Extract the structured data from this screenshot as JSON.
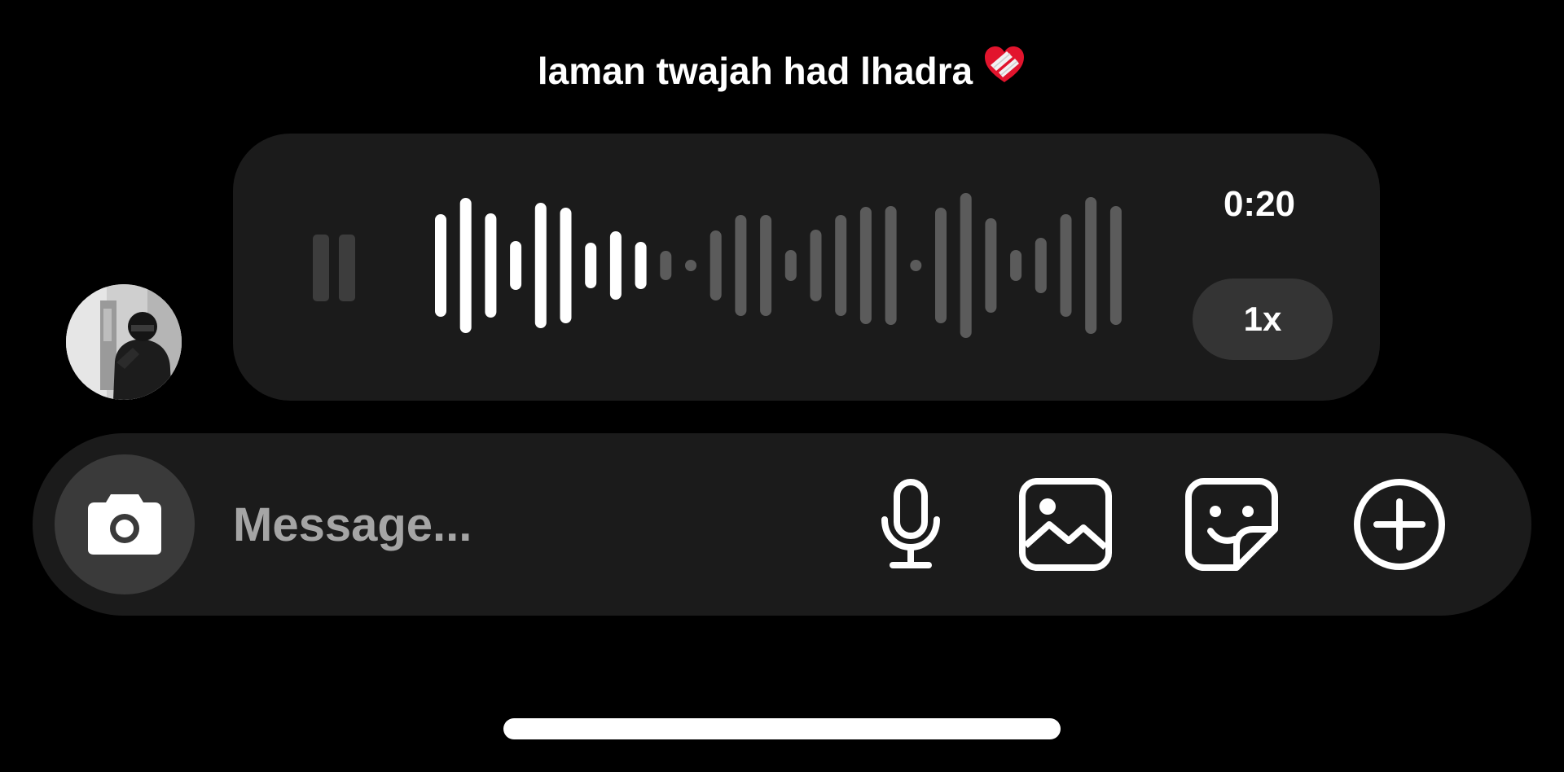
{
  "caption": {
    "text": "laman twajah had lhadra",
    "emoji_icon": "mending-heart-icon"
  },
  "voice_message": {
    "state_icon": "pause-icon",
    "duration": "0:20",
    "playback_speed": "1x",
    "playback_progress": 0.33,
    "waveform_levels": [
      0.63,
      0.83,
      0.64,
      0.3,
      0.77,
      0.71,
      0.28,
      0.42,
      0.29,
      0.18,
      0.04,
      0.43,
      0.62,
      0.62,
      0.19,
      0.44,
      0.62,
      0.72,
      0.73,
      0.02,
      0.71,
      0.89,
      0.58,
      0.19,
      0.34,
      0.63,
      0.84,
      0.73
    ],
    "played_color": "#ffffff",
    "unplayed_color": "#5b5b5b"
  },
  "composer": {
    "camera_icon": "camera-icon",
    "placeholder": "Message...",
    "value": "",
    "actions": [
      {
        "icon": "microphone-icon",
        "label": "microphone"
      },
      {
        "icon": "image-gallery-icon",
        "label": "gallery"
      },
      {
        "icon": "sticker-icon",
        "label": "sticker"
      },
      {
        "icon": "plus-circle-icon",
        "label": "more"
      }
    ]
  },
  "colors": {
    "background": "#000000",
    "bubble": "#1b1b1b",
    "speed_pill": "#343434",
    "camera_button": "#3a3a3a",
    "placeholder_text": "#a5a5a5"
  }
}
